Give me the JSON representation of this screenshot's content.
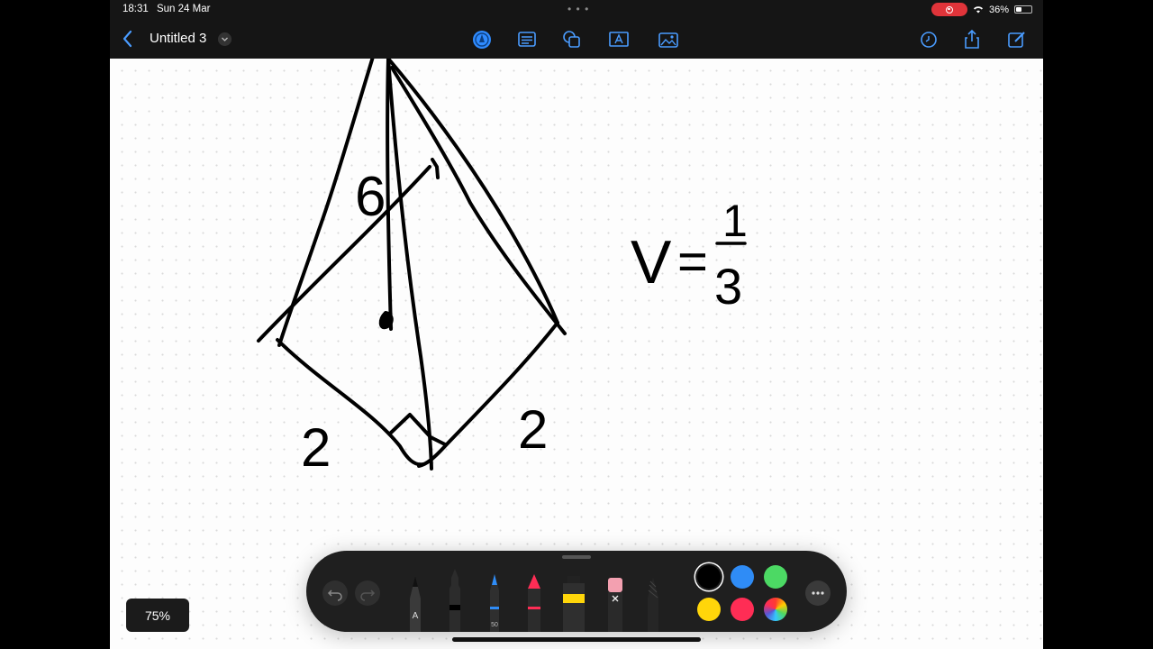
{
  "status": {
    "time": "18:31",
    "date": "Sun 24 Mar",
    "battery": "36%",
    "battery_level": 0.36
  },
  "toolbar": {
    "title": "Untitled 3",
    "icons": [
      "back-chevron-icon",
      "pen-tool-icon",
      "text-lines-icon",
      "shapes-icon",
      "text-box-icon",
      "image-icon",
      "history-icon",
      "share-icon",
      "compose-icon"
    ],
    "accent_color": "#2f8bff"
  },
  "canvas": {
    "handwriting": {
      "height_label": "6",
      "base_label_left": "2",
      "base_label_right": "2",
      "formula_v": "V",
      "formula_eq": "=",
      "formula_num": "1",
      "formula_den": "3"
    }
  },
  "palette": {
    "tools": [
      "pencil-tool",
      "fineliner-tool",
      "pen-50-tool",
      "marker-tool",
      "highlighter-tool",
      "eraser-tool",
      "crayon-tool"
    ],
    "pen_size_label": "50",
    "pencil_label": "A",
    "colors": [
      "#000000",
      "#2f8cf6",
      "#4cd964",
      "#ffd60a",
      "#ff2d55"
    ],
    "selected_color": "#000000"
  },
  "zoom": {
    "label": "75%"
  }
}
